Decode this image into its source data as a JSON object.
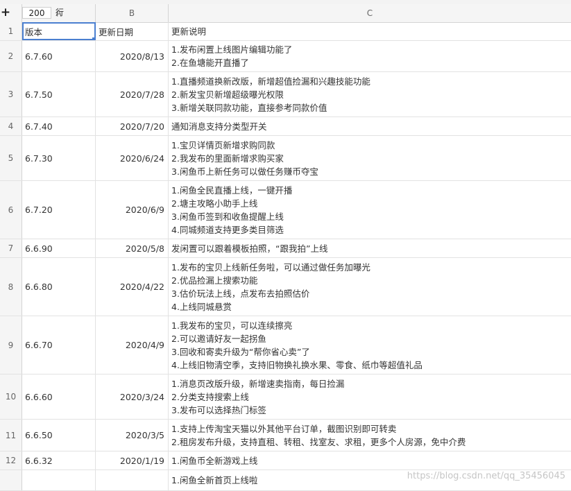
{
  "toolbar": {
    "add_label": "+",
    "row_count": "200",
    "row_unit": "行"
  },
  "columns": [
    "A",
    "B",
    "C"
  ],
  "rows": [
    {
      "num": "1",
      "a": "版本",
      "b": "更新日期",
      "c": [
        "更新说明"
      ]
    },
    {
      "num": "2",
      "a": "6.7.60",
      "b": "2020/8/13",
      "c": [
        "1.发布闲置上线图片编辑功能了",
        "2.在鱼塘能开直播了"
      ]
    },
    {
      "num": "3",
      "a": "6.7.50",
      "b": "2020/7/28",
      "c": [
        "1.直播频道换新改版，新增超值捡漏和兴趣技能功能",
        "2.新发宝贝新增超级曝光权限",
        "3.新增关联同款功能，直接参考同款价值"
      ]
    },
    {
      "num": "4",
      "a": "6.7.40",
      "b": "2020/7/20",
      "c": [
        "通知消息支持分类型开关"
      ]
    },
    {
      "num": "5",
      "a": "6.7.30",
      "b": "2020/6/24",
      "c": [
        "1.宝贝详情页新增求购同款",
        "2.我发布的里面新增求购买家",
        "3.闲鱼币上新任务可以做任务赚币夺宝"
      ]
    },
    {
      "num": "6",
      "a": "6.7.20",
      "b": "2020/6/9",
      "c": [
        "1.闲鱼全民直播上线，一键开播",
        "2.塘主攻略小助手上线",
        "3.闲鱼币签到和收鱼提醒上线",
        "4.同城频道支持更多类目筛选"
      ]
    },
    {
      "num": "7",
      "a": "6.6.90",
      "b": "2020/5/8",
      "c": [
        "发闲置可以跟着模板拍照，“跟我拍”上线"
      ]
    },
    {
      "num": "8",
      "a": "6.6.80",
      "b": "2020/4/22",
      "c": [
        "1.发布的宝贝上线新任务啦，可以通过做任务加曝光",
        "2.优品捡漏上搜索功能",
        "3.估价玩法上线，点发布去拍照估价",
        "4.上线同城悬赏"
      ]
    },
    {
      "num": "9",
      "a": "6.6.70",
      "b": "2020/4/9",
      "c": [
        "1.我发布的宝贝，可以连续擦亮",
        "2.可以邀请好友一起拐鱼",
        "3.回收和寄卖升级为“帮你省心卖”了",
        "4.上线旧物清空季，支持旧物换礼换水果、零食、纸巾等超值礼品"
      ]
    },
    {
      "num": "10",
      "a": "6.6.60",
      "b": "2020/3/24",
      "c": [
        "1.消息页改版升级，新增速卖指南，每日捡漏",
        "2.分类支持搜索上线",
        "3.发布可以选择热门标签"
      ]
    },
    {
      "num": "11",
      "a": "6.6.50",
      "b": "2020/3/5",
      "c": [
        "1.支持上传淘宝天猫以外其他平台订单，截图识别即可转卖",
        "2.租房发布升级，支持直租、转租、找室友、求租，更多个人房源，免中介费"
      ]
    },
    {
      "num": "12",
      "a": "6.6.32",
      "b": "2020/1/19",
      "c": [
        "1.闲鱼币全新游戏上线"
      ]
    },
    {
      "num": "",
      "a": "",
      "b": "",
      "c": [
        "1.闲鱼全新首页上线啦"
      ]
    }
  ],
  "watermark": "https://blog.csdn.net/qq_35456045"
}
